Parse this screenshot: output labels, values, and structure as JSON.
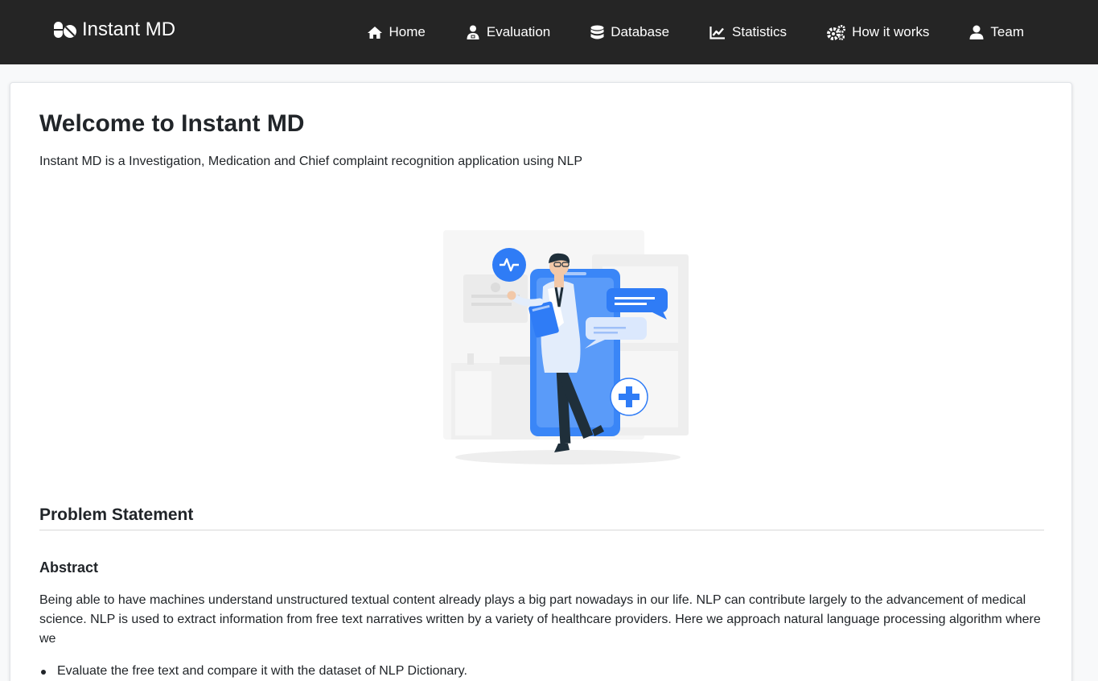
{
  "brand": {
    "name": "Instant MD",
    "icon": "pills-icon"
  },
  "nav": {
    "items": [
      {
        "label": "Home",
        "icon": "home-icon"
      },
      {
        "label": "Evaluation",
        "icon": "user-doctor-icon"
      },
      {
        "label": "Database",
        "icon": "database-icon"
      },
      {
        "label": "Statistics",
        "icon": "chart-line-icon"
      },
      {
        "label": "How it works",
        "icon": "cogs-icon"
      },
      {
        "label": "Team",
        "icon": "user-icon"
      }
    ]
  },
  "main": {
    "title": "Welcome to Instant MD",
    "subtitle": "Instant MD is a Investigation, Medication and Chief complaint recognition application using NLP",
    "section_title": "Problem Statement",
    "abstract_title": "Abstract",
    "abstract_text": "Being able to have machines understand unstructured textual content already plays a big part nowadays in our life. NLP can contribute largely to the advancement of medical science. NLP is used to extract information from free text narratives written by a variety of healthcare providers. Here we approach natural language processing algorithm where we",
    "bullets": [
      "Evaluate the free text and compare it with the dataset of NLP Dictionary."
    ]
  },
  "colors": {
    "navbar_bg": "#252525",
    "accent_blue": "#2F7CF6",
    "text": "#212529"
  }
}
